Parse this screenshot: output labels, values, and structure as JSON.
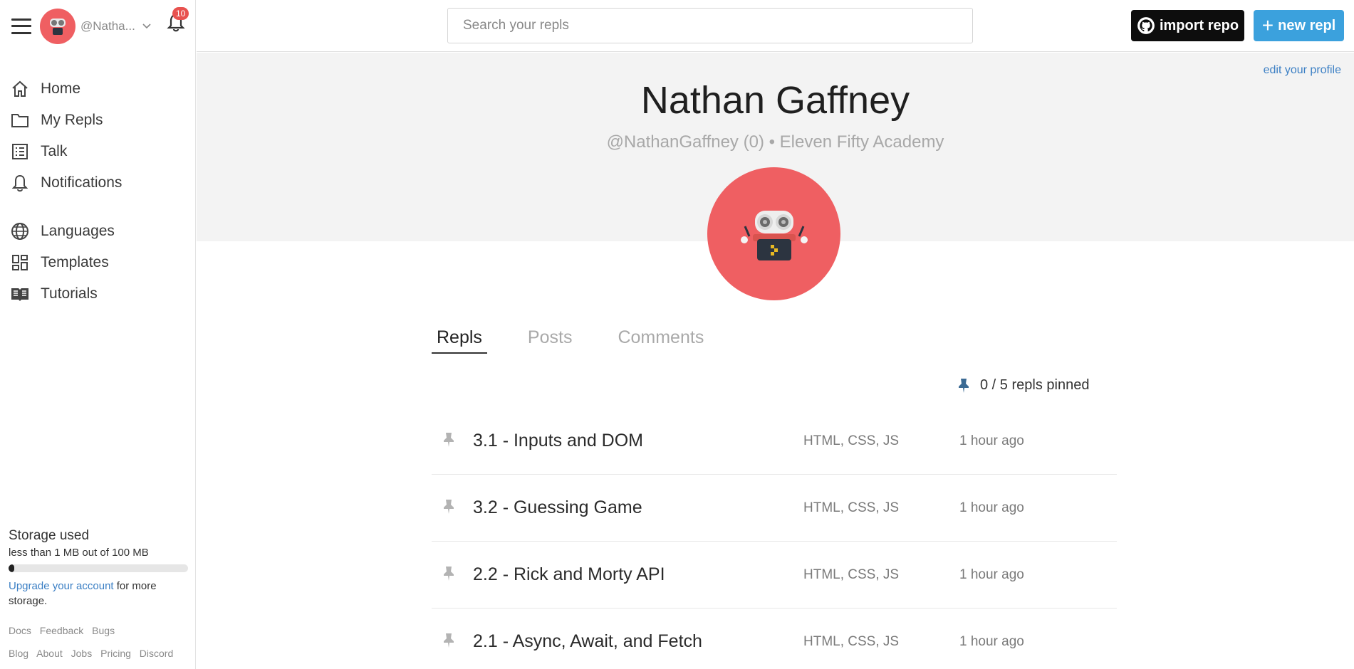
{
  "user": {
    "short_handle": "@Natha...",
    "notification_count": "10"
  },
  "nav": {
    "items": [
      {
        "label": "Home",
        "icon": "home-icon"
      },
      {
        "label": "My Repls",
        "icon": "folder-icon"
      },
      {
        "label": "Talk",
        "icon": "list-icon"
      },
      {
        "label": "Notifications",
        "icon": "bell-icon"
      },
      {
        "label": "Languages",
        "icon": "globe-icon"
      },
      {
        "label": "Templates",
        "icon": "templates-icon"
      },
      {
        "label": "Tutorials",
        "icon": "book-icon"
      }
    ]
  },
  "storage": {
    "title": "Storage used",
    "detail": "less than 1 MB out of 100 MB",
    "used_fraction": 0.01,
    "upgrade_link": "Upgrade your account",
    "upgrade_rest": " for more storage."
  },
  "footer": {
    "row1": [
      "Docs",
      "Feedback",
      "Bugs"
    ],
    "row2": [
      "Blog",
      "About",
      "Jobs",
      "Pricing",
      "Discord"
    ]
  },
  "header": {
    "search_placeholder": "Search your repls",
    "import_label": "import repo",
    "new_label": "new repl"
  },
  "profile": {
    "edit_label": "edit your profile",
    "name": "Nathan Gaffney",
    "handle_line": "@NathanGaffney (0) • Eleven Fifty Academy"
  },
  "tabs": [
    "Repls",
    "Posts",
    "Comments"
  ],
  "pinned_text": "0 / 5 repls pinned",
  "repls": [
    {
      "title": "3.1 - Inputs and DOM",
      "langs": "HTML, CSS, JS",
      "time": "1 hour ago"
    },
    {
      "title": "3.2 - Guessing Game",
      "langs": "HTML, CSS, JS",
      "time": "1 hour ago"
    },
    {
      "title": "2.2 - Rick and Morty API",
      "langs": "HTML, CSS, JS",
      "time": "1 hour ago"
    },
    {
      "title": "2.1 - Async, Await, and Fetch",
      "langs": "HTML, CSS, JS",
      "time": "1 hour ago"
    }
  ],
  "colors": {
    "avatar_bg": "#ef5f62",
    "new_repl_button": "#3ba1dd",
    "import_button": "#0d0d0d",
    "link": "#3b7fc4",
    "banner_bg": "#f3f3f3"
  }
}
